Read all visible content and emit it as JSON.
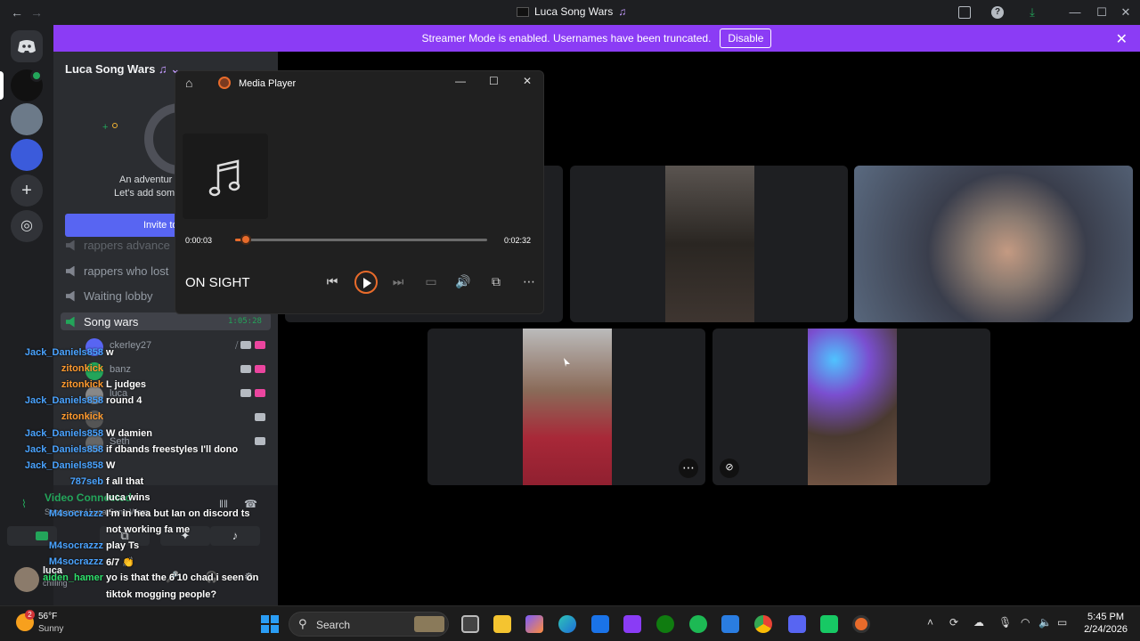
{
  "window": {
    "title": "Luca Song Wars",
    "back": "←",
    "forward": "→",
    "minimize": "—",
    "maximize": "☐",
    "close": "✕"
  },
  "banner": {
    "text": "Streamer Mode is enabled. Usernames have been truncated.",
    "disable_label": "Disable",
    "close": "✕"
  },
  "sidebar": {
    "server_name": "Luca Song Wars",
    "invite_text_1": "An adventur",
    "invite_text_2": "Let's add som",
    "invite_button": "Invite to S",
    "channels": [
      "rappers who lost",
      "Waiting lobby",
      "Song wars"
    ],
    "partial_channel": "rappers advance",
    "active_channel_timer": "1:05:28",
    "voice_users": [
      "ckerley27",
      "banz",
      "luca",
      "",
      "Seth"
    ]
  },
  "voice_panel": {
    "status": "Video Connected",
    "location": "Song wars / Luca Song Wars",
    "user_name": "luca",
    "user_status": "chilling"
  },
  "media_player": {
    "title": "Media Player",
    "elapsed": "0:00:03",
    "duration": "0:02:32",
    "track": "ON SIGHT",
    "progress": 0.02
  },
  "chat": [
    {
      "user": "Jack_Daniels858",
      "text": "w",
      "color": "#4aa3ff"
    },
    {
      "user": "zitonkick",
      "text": "",
      "color": "#ff9a2e"
    },
    {
      "user": "zitonkick",
      "text": "L judges",
      "color": "#ff9a2e"
    },
    {
      "user": "Jack_Daniels858",
      "text": "round 4",
      "color": "#4aa3ff"
    },
    {
      "user": "zitonkick",
      "text": "",
      "color": "#ff9a2e"
    },
    {
      "user": "Jack_Daniels858",
      "text": "W damien",
      "color": "#4aa3ff"
    },
    {
      "user": "Jack_Daniels858",
      "text": "if dbands freestyles I'll dono",
      "color": "#4aa3ff"
    },
    {
      "user": "Jack_Daniels858",
      "text": "W",
      "color": "#4aa3ff"
    },
    {
      "user": "787seb",
      "text": "f all that",
      "color": "#4aa3ff"
    },
    {
      "user": "",
      "text": "luca wins",
      "color": "#4aa3ff"
    },
    {
      "user": "M4socrazzz",
      "text": "I'm in hea but Ian on discord ts",
      "color": "#4aa3ff"
    },
    {
      "user": "",
      "text": "not working fa me",
      "color": "#4aa3ff"
    },
    {
      "user": "M4socrazzz",
      "text": "play Ts",
      "color": "#4aa3ff"
    },
    {
      "user": "M4socrazzz",
      "text": "6/7 👏",
      "color": "#4aa3ff"
    },
    {
      "user": "aiden_hamer",
      "text": "yo is that the 6'10 chad i seen on",
      "color": "#2ee06b"
    },
    {
      "user": "",
      "text": "tiktok mogging people?",
      "color": "#2ee06b"
    }
  ],
  "taskbar": {
    "weather_temp": "56°F",
    "weather_desc": "Sunny",
    "weather_badge": "2",
    "search": "Search",
    "time": "5:45 PM",
    "date": "2/24/2026"
  }
}
